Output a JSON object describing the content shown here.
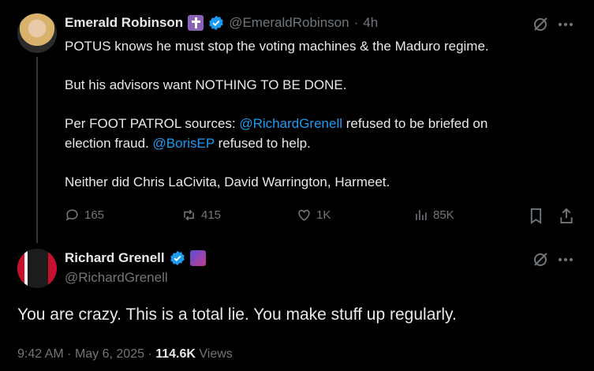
{
  "tweet1": {
    "name": "Emerald Robinson",
    "emoji": "✝️",
    "handle": "@EmeraldRobinson",
    "separator": "·",
    "time": "4h",
    "lines": {
      "l1": "POTUS knows he must stop the voting machines & the Maduro regime.",
      "l2": "But his advisors want NOTHING TO BE DONE.",
      "l3a": "Per FOOT PATROL sources: ",
      "l3mention": "@RichardGrenell",
      "l3b": " refused to be briefed on",
      "l4a": "election fraud. ",
      "l4mention": "@BorisEP",
      "l4b": " refused to help.",
      "l5": "Neither did Chris LaCivita, David Warrington, Harmeet."
    },
    "actions": {
      "replies": "165",
      "reposts": "415",
      "likes": "1K",
      "views": "85K"
    }
  },
  "tweet2": {
    "name": "Richard Grenell",
    "handle": "@RichardGrenell",
    "text": "You are crazy. This is a total lie. You make stuff up regularly.",
    "time": "9:42 AM",
    "dot": "·",
    "date": "May 6, 2025",
    "dot2": "·",
    "views_count": "114.6K",
    "views_label": "Views"
  },
  "colors": {
    "background": "#000000",
    "text": "#e7e9ea",
    "muted": "#71767b",
    "link": "#1d9bf0",
    "verified": "#1d9bf0",
    "thread_line": "#333639"
  }
}
